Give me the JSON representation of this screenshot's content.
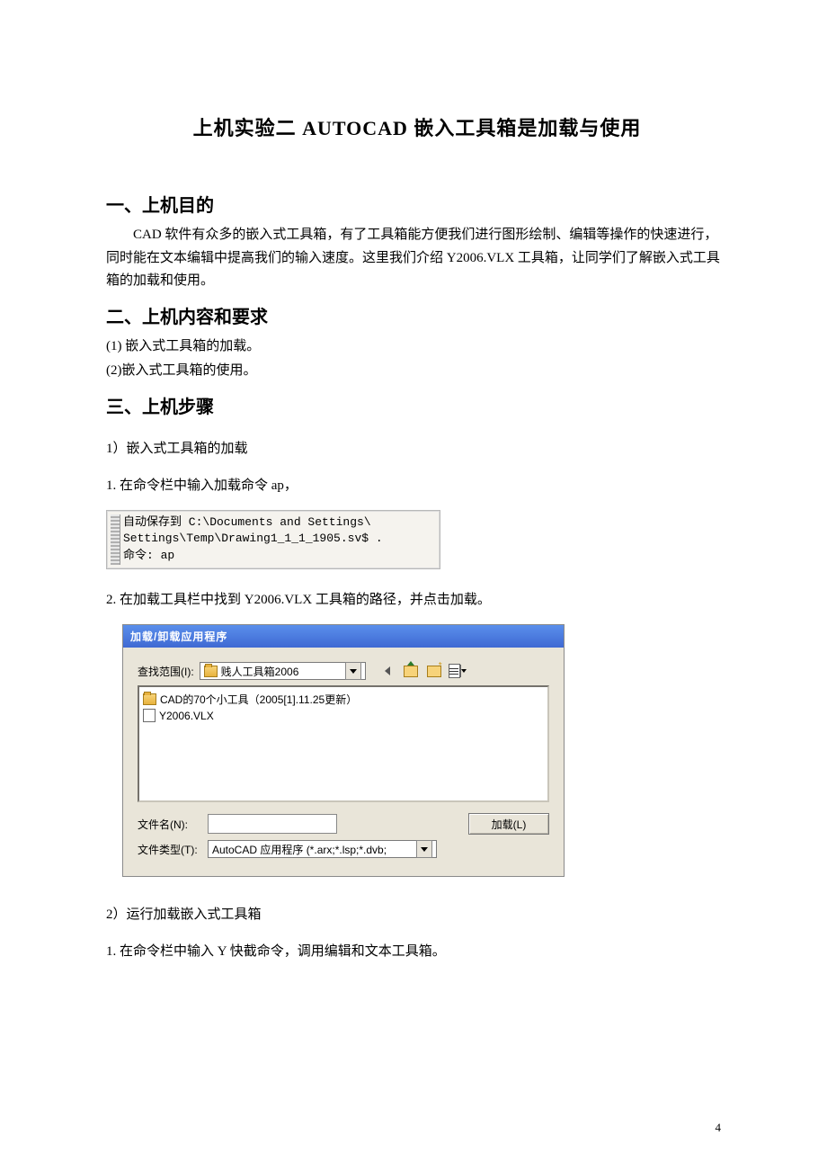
{
  "title": "上机实验二 AUTOCAD 嵌入工具箱是加载与使用",
  "sec1_h": "一、上机目的",
  "sec1_p": "CAD 软件有众多的嵌入式工具箱，有了工具箱能方便我们进行图形绘制、编辑等操作的快速进行，同时能在文本编辑中提高我们的输入速度。这里我们介绍 Y2006.VLX 工具箱，让同学们了解嵌入式工具箱的加载和使用。",
  "sec2_h": "二、上机内容和要求",
  "sec2_li1": "(1) 嵌入式工具箱的加载。",
  "sec2_li2": "(2)嵌入式工具箱的使用。",
  "sec3_h": "三、上机步骤",
  "step_1": "1）嵌入式工具箱的加载",
  "step_1_1": "1. 在命令栏中输入加载命令 ap，",
  "cmd_line1": "自动保存到 C:\\Documents and Settings\\",
  "cmd_line2": "Settings\\Temp\\Drawing1_1_1_1905.sv$ .",
  "cmd_line3": "命令: ap",
  "step_1_2": "2. 在加载工具栏中找到 Y2006.VLX 工具箱的路径，并点击加载。",
  "dlg": {
    "title": "加载/卸载应用程序",
    "lookin_label": "查找范围(I):",
    "lookin_value": "贱人工具箱2006",
    "file_item1": "CAD的70个小工具（2005[1].11.25更新）",
    "file_item2": "Y2006.VLX",
    "filename_label": "文件名(N):",
    "filetype_label": "文件类型(T):",
    "filetype_value": "AutoCAD 应用程序 (*.arx;*.lsp;*.dvb;",
    "load_btn": "加载(L)"
  },
  "step_2": "2）运行加载嵌入式工具箱",
  "step_2_1": "1. 在命令栏中输入 Y 快截命令，调用编辑和文本工具箱。",
  "page_number": "4"
}
